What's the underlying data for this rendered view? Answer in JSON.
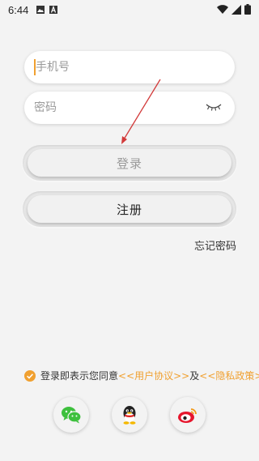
{
  "status_bar": {
    "time": "6:44"
  },
  "login_form": {
    "phone_placeholder": "手机号",
    "phone_value": "",
    "password_placeholder": "密码",
    "password_value": ""
  },
  "buttons": {
    "login_label": "登录",
    "register_label": "注册",
    "forgot_label": "忘记密码"
  },
  "agreement": {
    "prefix": "登录即表示您同意",
    "user_agreement": "<<用户协议>>",
    "and": "及",
    "privacy_policy": "<<隐私政策>>",
    "checked": true
  },
  "social": [
    "wechat-icon",
    "qq-icon",
    "weibo-icon"
  ],
  "colors": {
    "accent": "#f0a030",
    "background": "#f3f3f3",
    "arrow": "#d23a3a"
  }
}
